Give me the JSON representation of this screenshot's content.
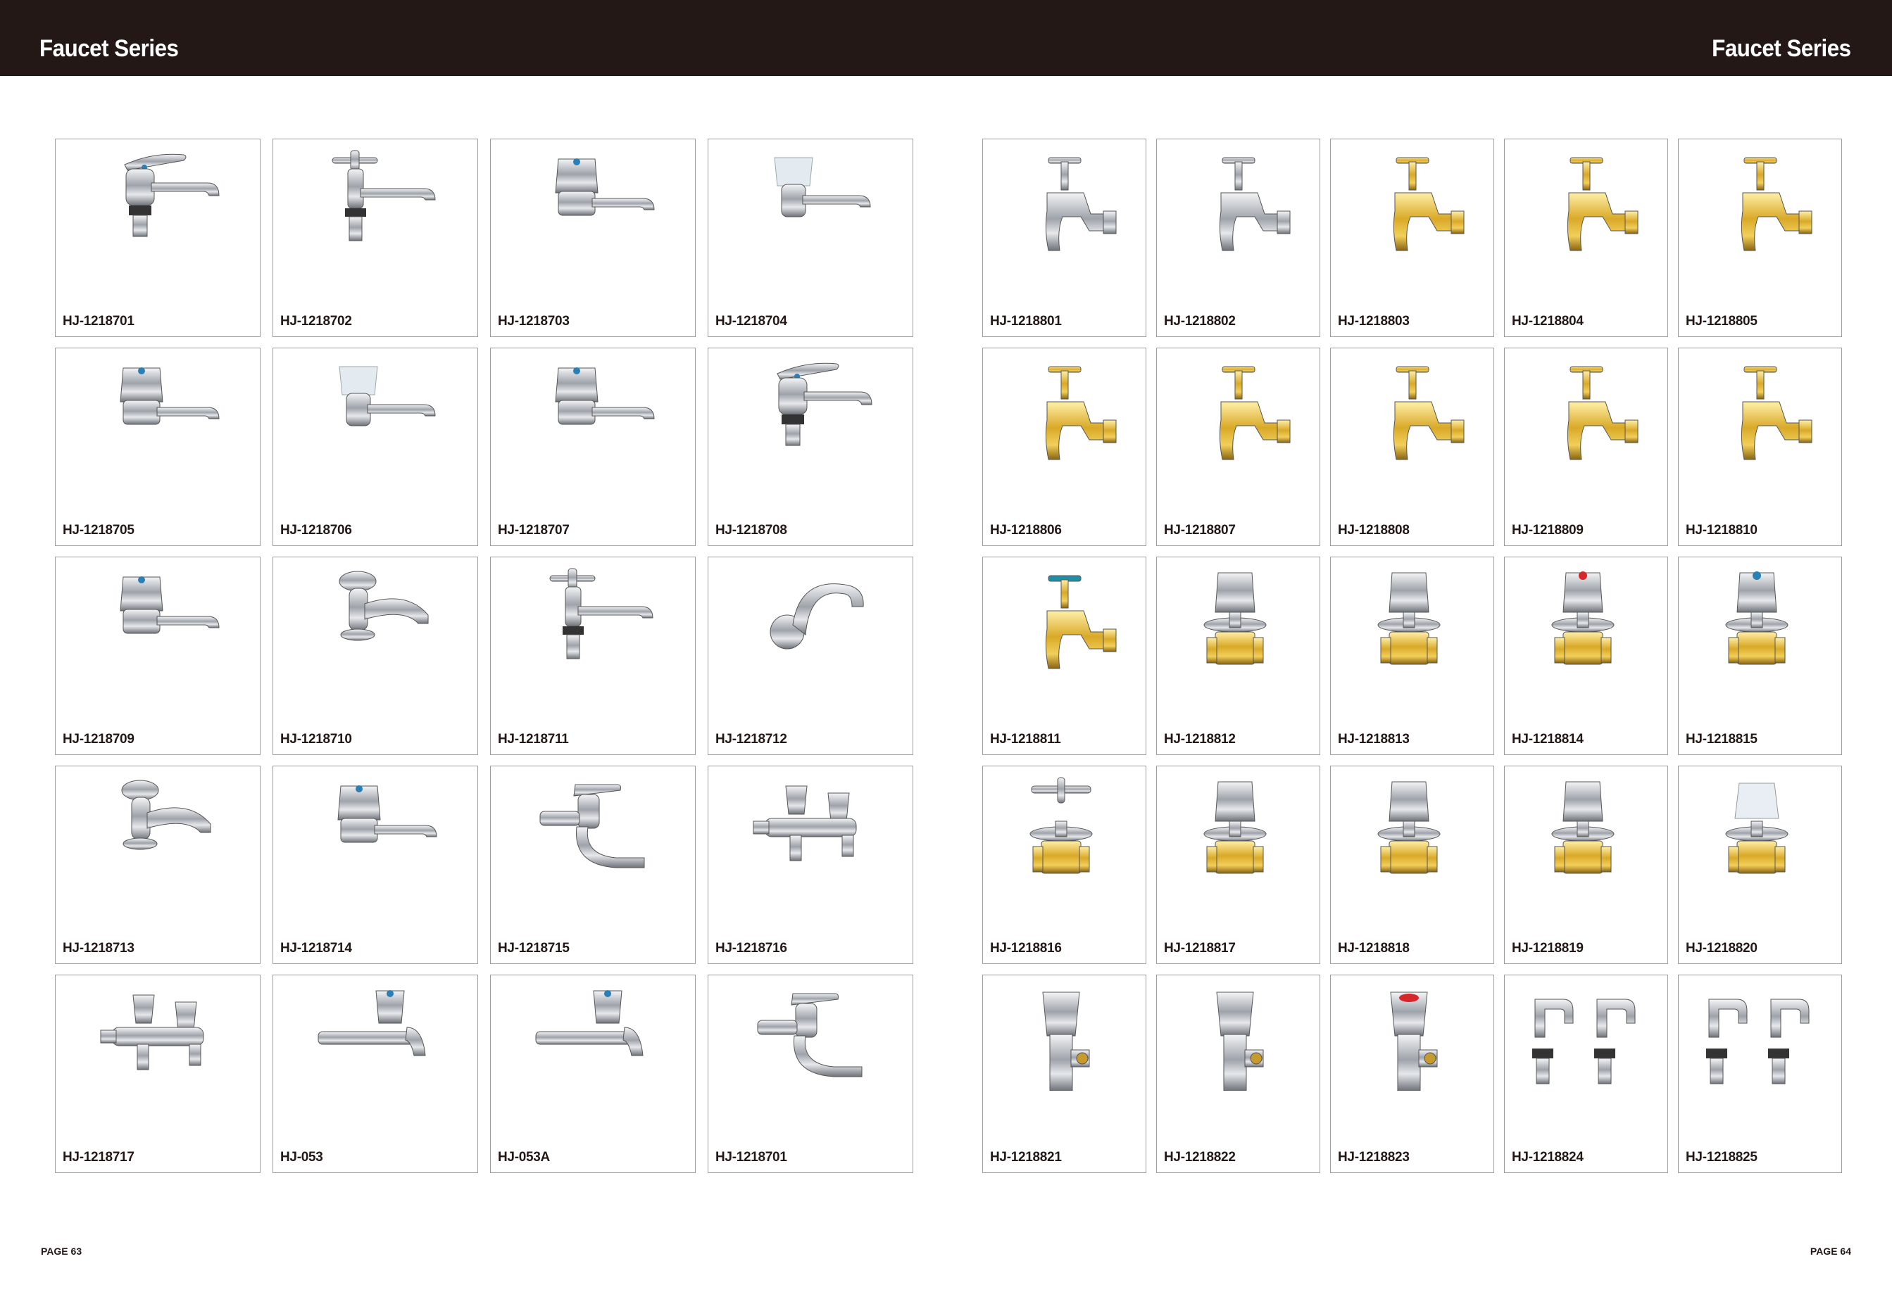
{
  "header": {
    "left_title": "Faucet Series",
    "right_title": "Faucet Series"
  },
  "footer": {
    "left_page": "PAGE 63",
    "right_page": "PAGE 64"
  },
  "colors": {
    "header_bg": "#231815",
    "chrome": "#b8bcc2",
    "brass": "#d9a928",
    "handle_blue": "#2a7fb5",
    "handle_red": "#d6282b",
    "teal_handle": "#1f8fa6"
  },
  "left_products": [
    {
      "code": "HJ-1218701",
      "icon": "lever-basin-tap-icon"
    },
    {
      "code": "HJ-1218702",
      "icon": "cross-handle-basin-tap-icon"
    },
    {
      "code": "HJ-1218703",
      "icon": "dome-handle-basin-tap-icon"
    },
    {
      "code": "HJ-1218704",
      "icon": "crystal-handle-basin-tap-icon"
    },
    {
      "code": "HJ-1218705",
      "icon": "dome-handle-basin-tap-icon"
    },
    {
      "code": "HJ-1218706",
      "icon": "crystal-handle-basin-tap-icon"
    },
    {
      "code": "HJ-1218707",
      "icon": "dome-handle-basin-tap-icon"
    },
    {
      "code": "HJ-1218708",
      "icon": "lever-basin-tap-icon"
    },
    {
      "code": "HJ-1218709",
      "icon": "dome-handle-basin-tap-icon"
    },
    {
      "code": "HJ-1218710",
      "icon": "knob-basin-tap-icon"
    },
    {
      "code": "HJ-1218711",
      "icon": "cross-handle-basin-tap-icon"
    },
    {
      "code": "HJ-1218712",
      "icon": "swan-neck-tap-icon"
    },
    {
      "code": "HJ-1218713",
      "icon": "knob-basin-tap-icon"
    },
    {
      "code": "HJ-1218714",
      "icon": "dome-handle-basin-tap-icon"
    },
    {
      "code": "HJ-1218715",
      "icon": "lever-wall-tap-icon"
    },
    {
      "code": "HJ-1218716",
      "icon": "double-outlet-tap-icon"
    },
    {
      "code": "HJ-1218717",
      "icon": "double-outlet-tap-icon"
    },
    {
      "code": "HJ-053",
      "icon": "long-wall-tap-icon"
    },
    {
      "code": "HJ-053A",
      "icon": "long-wall-tap-icon"
    },
    {
      "code": "HJ-1218701",
      "icon": "lever-wall-tap-icon"
    }
  ],
  "right_products": [
    {
      "code": "HJ-1218801",
      "icon": "chrome-bib-tap-icon"
    },
    {
      "code": "HJ-1218802",
      "icon": "chrome-bib-tap-icon"
    },
    {
      "code": "HJ-1218803",
      "icon": "brass-bib-tap-icon"
    },
    {
      "code": "HJ-1218804",
      "icon": "brass-bib-tap-icon"
    },
    {
      "code": "HJ-1218805",
      "icon": "brass-bib-tap-icon"
    },
    {
      "code": "HJ-1218806",
      "icon": "brass-bib-tap-icon"
    },
    {
      "code": "HJ-1218807",
      "icon": "brass-bib-tap-icon"
    },
    {
      "code": "HJ-1218808",
      "icon": "brass-bib-tap-icon"
    },
    {
      "code": "HJ-1218809",
      "icon": "brass-bib-tap-icon"
    },
    {
      "code": "HJ-1218810",
      "icon": "brass-bib-tap-icon"
    },
    {
      "code": "HJ-1218811",
      "icon": "teal-handle-bib-tap-icon"
    },
    {
      "code": "HJ-1218812",
      "icon": "stop-valve-icon"
    },
    {
      "code": "HJ-1218813",
      "icon": "stop-valve-icon"
    },
    {
      "code": "HJ-1218814",
      "icon": "stop-valve-red-icon"
    },
    {
      "code": "HJ-1218815",
      "icon": "stop-valve-blue-icon"
    },
    {
      "code": "HJ-1218816",
      "icon": "cross-stop-valve-icon"
    },
    {
      "code": "HJ-1218817",
      "icon": "stop-valve-icon"
    },
    {
      "code": "HJ-1218818",
      "icon": "stop-valve-icon"
    },
    {
      "code": "HJ-1218819",
      "icon": "stop-valve-icon"
    },
    {
      "code": "HJ-1218820",
      "icon": "crystal-stop-valve-icon"
    },
    {
      "code": "HJ-1218821",
      "icon": "angle-valve-icon"
    },
    {
      "code": "HJ-1218822",
      "icon": "angle-valve-icon"
    },
    {
      "code": "HJ-1218823",
      "icon": "angle-valve-red-icon"
    },
    {
      "code": "HJ-1218824",
      "icon": "spout-pair-icon"
    },
    {
      "code": "HJ-1218825",
      "icon": "spout-pair-icon"
    }
  ]
}
